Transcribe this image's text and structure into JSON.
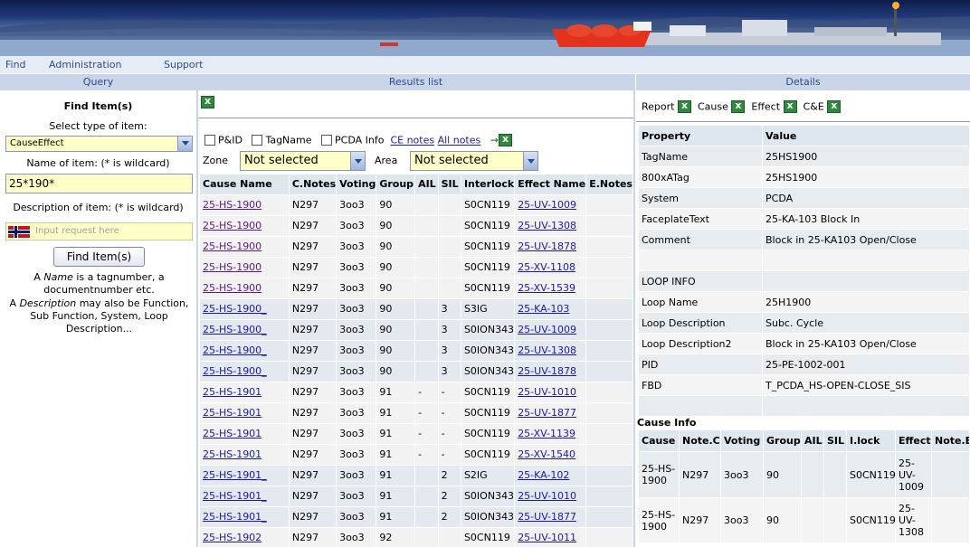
{
  "menu": {
    "find": "Find",
    "administration": "Administration",
    "support": "Support"
  },
  "panels": {
    "query": "Query",
    "results": "Results list",
    "details": "Details"
  },
  "query": {
    "title": "Find Item(s)",
    "type_label": "Select type of item:",
    "type_value": "CauseEffect",
    "name_label": "Name of item: (* is wildcard)",
    "name_value": "25*190*",
    "desc_label": "Description of item: (* is wildcard)",
    "desc_placeholder": "Input request here",
    "find_button": "Find Item(s)",
    "help1_a": "A ",
    "help1_em": "Name",
    "help1_b": " is a tagnumber, a documentnumber etc.",
    "help2_a": "A ",
    "help2_em": "Description",
    "help2_b": " may also be Function, Sub Function, System, Loop Description..."
  },
  "results": {
    "options": {
      "pid": "P&ID",
      "tagname": "TagName",
      "pcda_info": "PCDA Info",
      "ce_notes": "CE notes",
      "all_notes": "All notes",
      "arrow": "→"
    },
    "zone_label": "Zone",
    "zone_value": "Not selected",
    "area_label": "Area",
    "area_value": "Not selected",
    "columns": [
      "Cause Name",
      "C.Notes",
      "Voting",
      "Group",
      "AIL",
      "SIL",
      "Interlock",
      "Effect Name",
      "E.Notes"
    ],
    "rows": [
      {
        "cause": "25-HS-1900",
        "cnotes": "N297",
        "voting": "3oo3",
        "group": "90",
        "ail": "",
        "sil": "",
        "interlock": "S0CN119",
        "effect": "25-UV-1009",
        "enotes": "",
        "g": "g1",
        "visited": true
      },
      {
        "cause": "25-HS-1900",
        "cnotes": "N297",
        "voting": "3oo3",
        "group": "90",
        "ail": "",
        "sil": "",
        "interlock": "S0CN119",
        "effect": "25-UV-1308",
        "enotes": "",
        "g": "g1",
        "visited": true
      },
      {
        "cause": "25-HS-1900",
        "cnotes": "N297",
        "voting": "3oo3",
        "group": "90",
        "ail": "",
        "sil": "",
        "interlock": "S0CN119",
        "effect": "25-UV-1878",
        "enotes": "",
        "g": "g1",
        "visited": true
      },
      {
        "cause": "25-HS-1900",
        "cnotes": "N297",
        "voting": "3oo3",
        "group": "90",
        "ail": "",
        "sil": "",
        "interlock": "S0CN119",
        "effect": "25-XV-1108",
        "enotes": "",
        "g": "g1",
        "visited": true
      },
      {
        "cause": "25-HS-1900",
        "cnotes": "N297",
        "voting": "3oo3",
        "group": "90",
        "ail": "",
        "sil": "",
        "interlock": "S0CN119",
        "effect": "25-XV-1539",
        "enotes": "",
        "g": "g1",
        "visited": true
      },
      {
        "cause": "25-HS-1900_",
        "cnotes": "N297",
        "voting": "3oo3",
        "group": "90",
        "ail": "",
        "sil": "3",
        "interlock": "S3IG",
        "effect": "25-KA-103",
        "enotes": "",
        "g": "g2",
        "visited": false
      },
      {
        "cause": "25-HS-1900_",
        "cnotes": "N297",
        "voting": "3oo3",
        "group": "90",
        "ail": "",
        "sil": "3",
        "interlock": "S0ION343",
        "effect": "25-UV-1009",
        "enotes": "",
        "g": "g2",
        "visited": false
      },
      {
        "cause": "25-HS-1900_",
        "cnotes": "N297",
        "voting": "3oo3",
        "group": "90",
        "ail": "",
        "sil": "3",
        "interlock": "S0ION343",
        "effect": "25-UV-1308",
        "enotes": "",
        "g": "g2",
        "visited": false
      },
      {
        "cause": "25-HS-1900_",
        "cnotes": "N297",
        "voting": "3oo3",
        "group": "90",
        "ail": "",
        "sil": "3",
        "interlock": "S0ION343",
        "effect": "25-UV-1878",
        "enotes": "",
        "g": "g2",
        "visited": false
      },
      {
        "cause": "25-HS-1901",
        "cnotes": "N297",
        "voting": "3oo3",
        "group": "91",
        "ail": "-",
        "sil": "-",
        "interlock": "S0CN119",
        "effect": "25-UV-1010",
        "enotes": "",
        "g": "g3",
        "visited": false
      },
      {
        "cause": "25-HS-1901",
        "cnotes": "N297",
        "voting": "3oo3",
        "group": "91",
        "ail": "-",
        "sil": "-",
        "interlock": "S0CN119",
        "effect": "25-UV-1877",
        "enotes": "",
        "g": "g3",
        "visited": false
      },
      {
        "cause": "25-HS-1901",
        "cnotes": "N297",
        "voting": "3oo3",
        "group": "91",
        "ail": "-",
        "sil": "-",
        "interlock": "S0CN119",
        "effect": "25-XV-1139",
        "enotes": "",
        "g": "g3",
        "visited": false
      },
      {
        "cause": "25-HS-1901",
        "cnotes": "N297",
        "voting": "3oo3",
        "group": "91",
        "ail": "-",
        "sil": "-",
        "interlock": "S0CN119",
        "effect": "25-XV-1540",
        "enotes": "",
        "g": "g3",
        "visited": false
      },
      {
        "cause": "25-HS-1901_",
        "cnotes": "N297",
        "voting": "3oo3",
        "group": "91",
        "ail": "",
        "sil": "2",
        "interlock": "S2IG",
        "effect": "25-KA-102",
        "enotes": "",
        "g": "g4",
        "visited": false
      },
      {
        "cause": "25-HS-1901_",
        "cnotes": "N297",
        "voting": "3oo3",
        "group": "91",
        "ail": "",
        "sil": "2",
        "interlock": "S0ION343",
        "effect": "25-UV-1010",
        "enotes": "",
        "g": "g4",
        "visited": false
      },
      {
        "cause": "25-HS-1901_",
        "cnotes": "N297",
        "voting": "3oo3",
        "group": "91",
        "ail": "",
        "sil": "2",
        "interlock": "S0ION343",
        "effect": "25-UV-1877",
        "enotes": "",
        "g": "g4",
        "visited": false
      },
      {
        "cause": "25-HS-1902",
        "cnotes": "N297",
        "voting": "3oo3",
        "group": "92",
        "ail": "",
        "sil": "",
        "interlock": "S0CN119",
        "effect": "25-UV-1011",
        "enotes": "",
        "g": "g5",
        "visited": false
      }
    ]
  },
  "details": {
    "tools": {
      "report": "Report",
      "cause": "Cause",
      "effect": "Effect",
      "ce": "C&E"
    },
    "prop_header": [
      "Property",
      "Value"
    ],
    "properties": [
      {
        "k": "TagName",
        "v": "25HS1900"
      },
      {
        "k": "800xATag",
        "v": "25HS1900"
      },
      {
        "k": "System",
        "v": "PCDA"
      },
      {
        "k": "FaceplateText",
        "v": "25-KA-103 Block In"
      },
      {
        "k": "Comment",
        "v": "Block in 25-KA103 Open/Close"
      },
      {
        "k": "",
        "v": ""
      },
      {
        "k": "LOOP INFO",
        "v": ""
      },
      {
        "k": "Loop Name",
        "v": "25H1900"
      },
      {
        "k": "Loop Description",
        "v": "Subc. Cycle"
      },
      {
        "k": "Loop Description2",
        "v": "Block in 25-KA103 Open/Close"
      },
      {
        "k": "PID",
        "v": "25-PE-1002-001"
      },
      {
        "k": "FBD",
        "v": "T_PCDA_HS-OPEN-CLOSE_SIS"
      },
      {
        "k": "",
        "v": ""
      }
    ],
    "cause_info_title": "Cause Info",
    "ci_columns": [
      "Cause",
      "Note.C",
      "Voting",
      "Group",
      "AIL",
      "SIL",
      "I.lock",
      "Effect",
      "Note.E"
    ],
    "ci_rows": [
      {
        "cause": "25-HS-1900",
        "notec": "N297",
        "voting": "3oo3",
        "group": "90",
        "ail": "",
        "sil": "",
        "ilock": "S0CN119",
        "effect": "25-UV-1009",
        "notee": ""
      },
      {
        "cause": "25-HS-1900",
        "notec": "N297",
        "voting": "3oo3",
        "group": "90",
        "ail": "",
        "sil": "",
        "ilock": "S0CN119",
        "effect": "25-UV-1308",
        "notee": ""
      }
    ]
  }
}
